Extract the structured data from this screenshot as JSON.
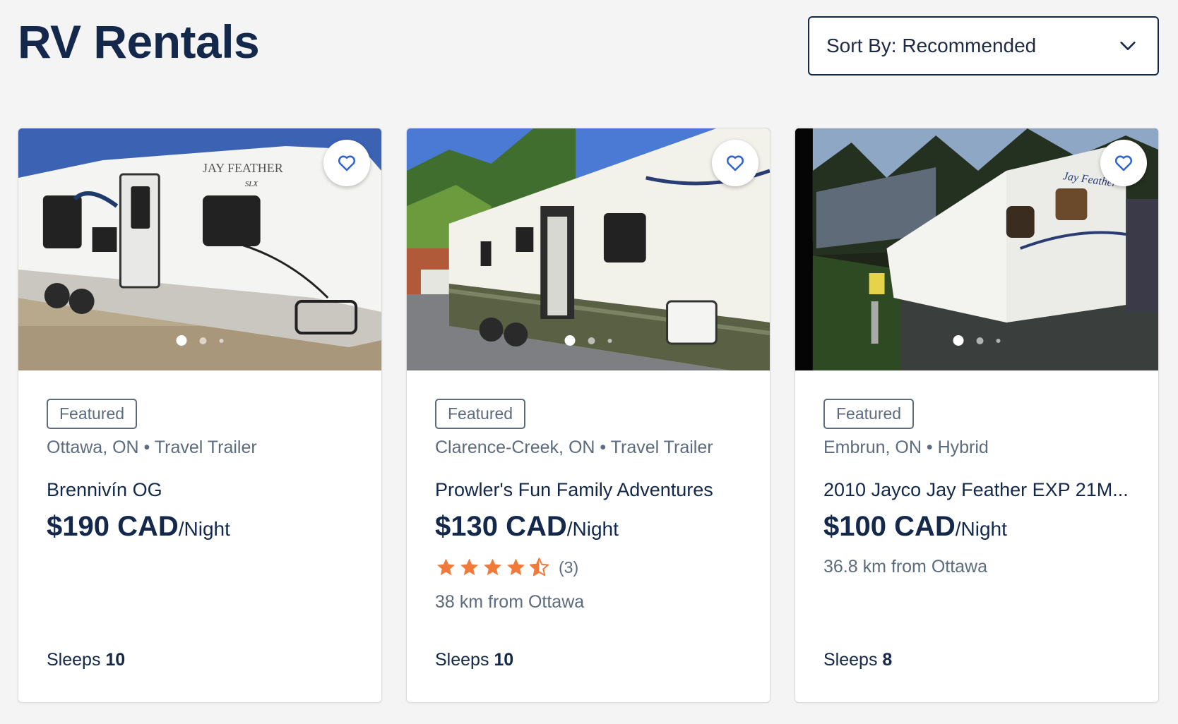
{
  "page": {
    "title": "RV Rentals"
  },
  "sort": {
    "label": "Sort By: Recommended"
  },
  "colors": {
    "accent": "#13284b",
    "star": "#f07a3a",
    "heart": "#2f64d6"
  },
  "listings": [
    {
      "badge": "Featured",
      "meta": "Ottawa, ON • Travel Trailer",
      "title": "Brennivín OG",
      "price": "$190 CAD",
      "unit": "/Night",
      "sleeps_label": "Sleeps",
      "sleeps": "10",
      "photo_text": [
        "JAY FEATHER",
        "SLX"
      ]
    },
    {
      "badge": "Featured",
      "meta": "Clarence-Creek, ON • Travel Trailer",
      "title": "Prowler's Fun Family Adventures",
      "price": "$130 CAD",
      "unit": "/Night",
      "rating": {
        "stars": 4.5,
        "count": "(3)"
      },
      "distance": "38 km from Ottawa",
      "sleeps_label": "Sleeps",
      "sleeps": "10"
    },
    {
      "badge": "Featured",
      "meta": "Embrun, ON • Hybrid",
      "title": "2010 Jayco Jay Feather EXP 21M...",
      "price": "$100 CAD",
      "unit": "/Night",
      "distance": "36.8 km from Ottawa",
      "sleeps_label": "Sleeps",
      "sleeps": "8",
      "photo_text": [
        "Jay Feather"
      ]
    }
  ]
}
